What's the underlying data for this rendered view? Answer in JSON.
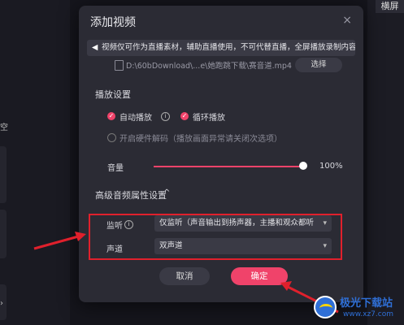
{
  "background": {
    "left_partial_text": "空",
    "right_tab": "横屏",
    "left_chevron": "›"
  },
  "dialog": {
    "title": "添加视频",
    "close_glyph": "×",
    "notice": "视频仅可作为直播素材，辅助直播使用，不可代替直播，全屏播放录制内容。",
    "file_path": "D:\\60bDownload\\...e\\她跑跳下载\\赛音道.mp4",
    "select_button": "选择",
    "playback_section": "播放设置",
    "autoplay_label": "自动播放",
    "loop_label": "循环播放",
    "hw_decode_label": "开启硬件解码（播放画面异常请关闭次选项）",
    "volume_label": "音量",
    "volume_value": "100%",
    "volume_level": 1.0,
    "advanced_section": "高级音频属性设置",
    "advanced_caret": "^",
    "monitor_label": "监听",
    "monitor_value": "仅监听（声音输出到扬声器，主播和观众都听得到",
    "channel_label": "声道",
    "channel_value": "双声道",
    "cancel_button": "取消",
    "ok_button": "确定"
  },
  "watermark": {
    "brand": "极光下载站",
    "url": "www.xz7.com"
  },
  "colors": {
    "accent": "#f0436a",
    "annotation": "#e0202c",
    "dialog_bg": "#2b2b34"
  }
}
